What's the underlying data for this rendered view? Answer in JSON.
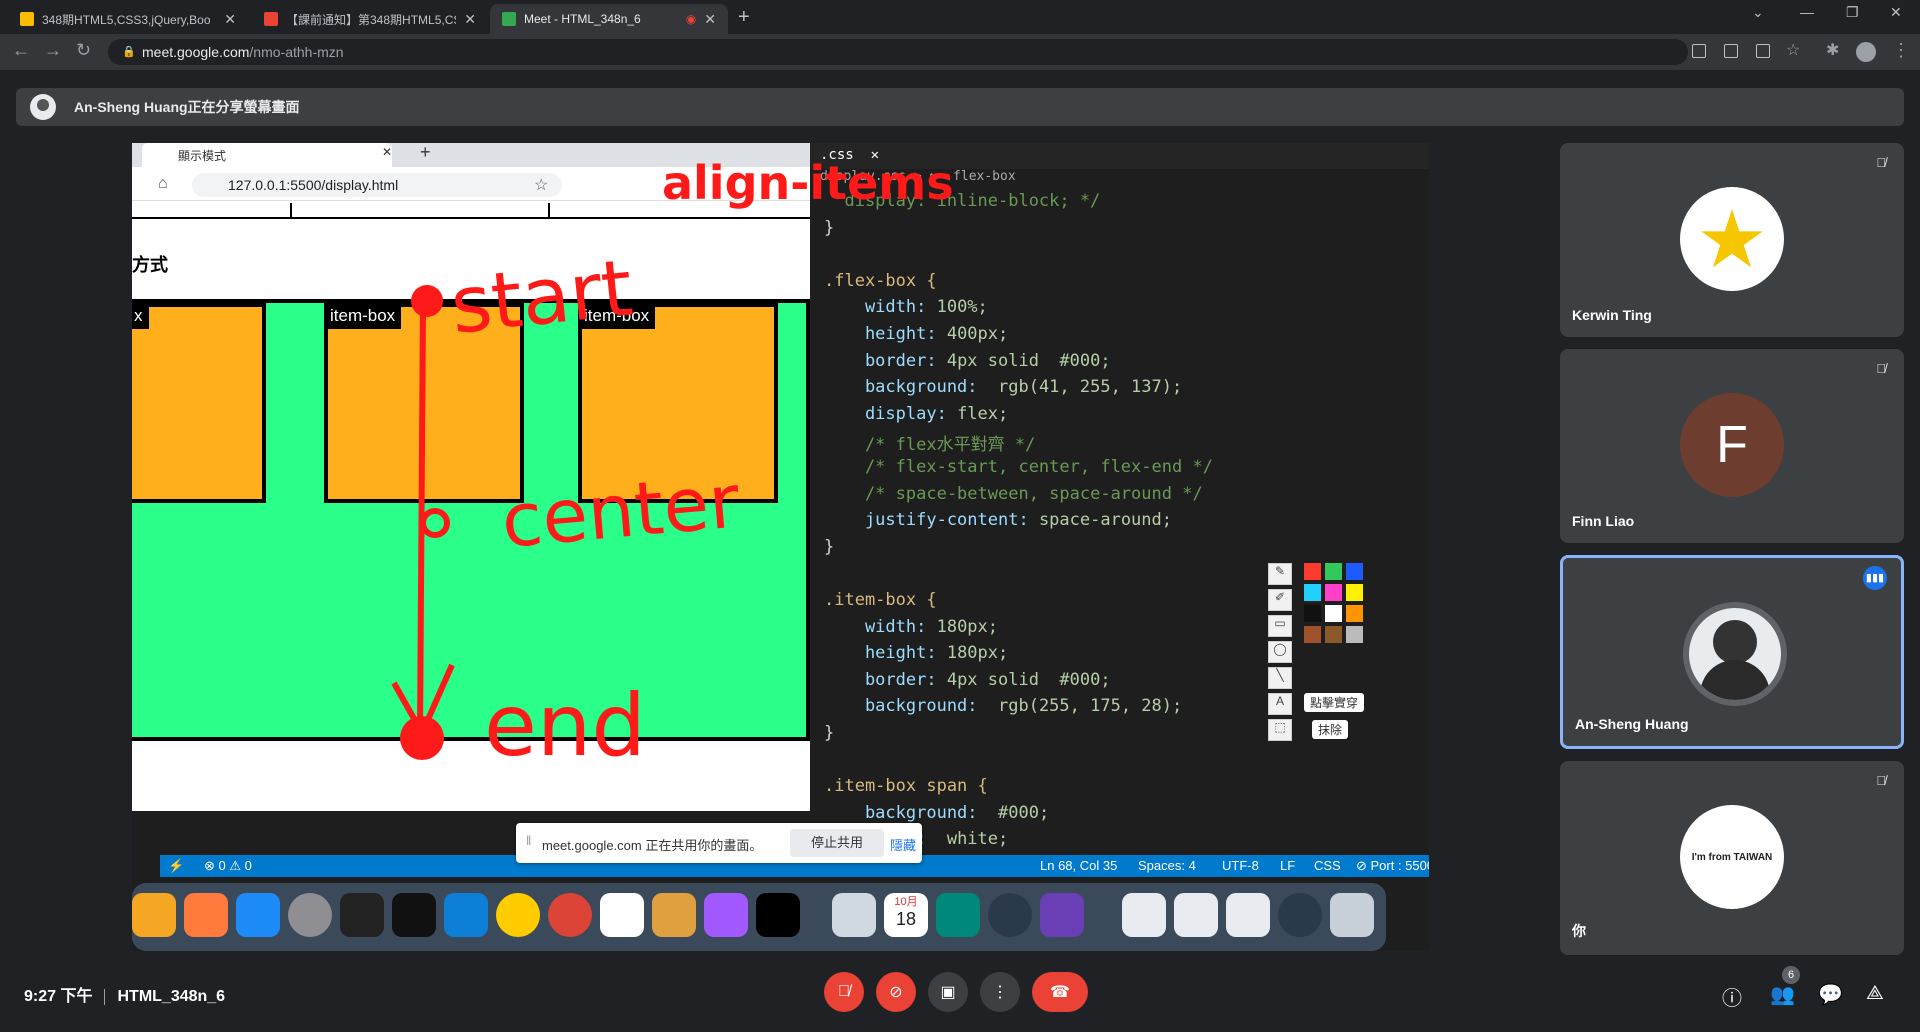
{
  "tabs": [
    {
      "title": "348期HTML5,CSS3,jQuery,Boo",
      "close": "✕",
      "color": "#fbbc04"
    },
    {
      "title": "【課前通知】第348期HTML5,CS",
      "close": "✕",
      "color": "#ea4335"
    },
    {
      "title": "Meet - HTML_348n_6",
      "close": "✕",
      "color": "#34a853"
    }
  ],
  "newtab": "+",
  "address": {
    "domain": "meet.google.com",
    "path": "/nmo-athh-mzn"
  },
  "banner": {
    "text": "An-Sheng Huang正在分享螢幕畫面"
  },
  "shared": {
    "browser_tab": "顯示模式",
    "browser_url": "127.0.0.1:5500/display.html",
    "heading": "方式",
    "items": [
      "x",
      "item-box",
      "item-box"
    ],
    "annotations": {
      "title": "align-items",
      "start": "start",
      "center": "center",
      "end": "end"
    },
    "editor_tab": ".css",
    "breadcrumb": "display.css > ⇆ .flex-box",
    "code": [
      "  display: inline-block; */",
      "}",
      "",
      ".flex-box {",
      "    width: 100%;",
      "    height: 400px;",
      "    border: 4px solid  #000;",
      "    background:  rgb(41, 255, 137);",
      "    display: flex;",
      "    /* flex水平對齊 */",
      "    /* flex-start, center, flex-end */",
      "    /* space-between, space-around */",
      "    justify-content: space-around;",
      "}",
      "",
      ".item-box {",
      "    width: 180px;",
      "    height: 180px;",
      "    border: 4px solid  #000;",
      "    background:  rgb(255, 175, 28);",
      "}",
      "",
      ".item-box span {",
      "    background:  #000;",
      "    color:  white;"
    ],
    "status": {
      "errors": "⊗ 0 ⚠ 0",
      "position": "Ln 68, Col 35",
      "spaces": "Spaces: 4",
      "encoding": "UTF-8",
      "eol": "LF",
      "lang": "CSS",
      "port": "⊘ Port : 5500"
    },
    "share_notice": {
      "message": "meet.google.com 正在共用你的畫面。",
      "stop": "停止共用",
      "hide": "隱藏"
    },
    "palette": {
      "highlight": "點擊實穿",
      "erase": "抹除",
      "colors": [
        "#ff3b30",
        "#34c759",
        "#1e5bff",
        "#20d0ff",
        "#ff40c8",
        "#fff200",
        "#111111",
        "#ffffff",
        "#ff9500",
        "#a0522d",
        "#8b5a2b",
        "#bbbbbb"
      ]
    },
    "calendar": {
      "month": "10月",
      "day": "18"
    }
  },
  "participants": [
    {
      "name": "Kerwin Ting",
      "muted": true
    },
    {
      "name": "Finn Liao",
      "initial": "F",
      "muted": true
    },
    {
      "name": "An-Sheng Huang",
      "speaking": true
    },
    {
      "name": "你",
      "sticker": "I'm from TAIWAN",
      "muted": true
    }
  ],
  "meeting": {
    "time": "9:27 下午",
    "code": "HTML_348n_6"
  },
  "people_count": "6",
  "colors": {
    "end_call": "#ea4335",
    "accent": "#8ab4f8",
    "ink": "#ff1a1a"
  }
}
